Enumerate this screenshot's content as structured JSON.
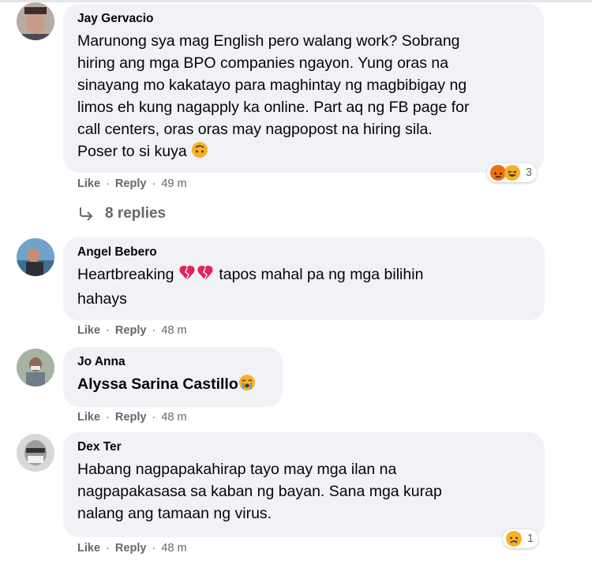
{
  "comments": [
    {
      "author": "Jay Gervacio",
      "text_lines": [
        "Marunong sya mag English pero walang work? Sobrang",
        "hiring ang mga BPO companies ngayon. Yung oras na",
        "sinayang mo kakatayo para maghintay ng magbibigay ng",
        "limos eh kung nagapply ka online. Part aq ng FB page for",
        "call centers, oras oras may nagpopost na hiring sila.",
        "Poser to si kuya"
      ],
      "like": "Like",
      "reply": "Reply",
      "time": "49 m",
      "reaction_count": "3",
      "reactions": [
        "angry-icon",
        "haha-icon"
      ],
      "replies_label": "8 replies"
    },
    {
      "author": "Angel Bebero",
      "text_line1_pre": "Heartbreaking",
      "text_line1_post": "tapos mahal pa ng mga bilihin",
      "text_line2": "hahays",
      "like": "Like",
      "reply": "Reply",
      "time": "48 m"
    },
    {
      "author": "Jo Anna",
      "mention": "Alyssa Sarina Castillo",
      "like": "Like",
      "reply": "Reply",
      "time": "48 m"
    },
    {
      "author": "Dex Ter",
      "text_lines": [
        "Habang nagpapakahirap tayo may mga ilan na",
        "nagpapakasasa sa kaban ng bayan. Sana mga kurap",
        "nalang ang tamaan ng virus."
      ],
      "like": "Like",
      "reply": "Reply",
      "time": "48 m",
      "reaction_count": "1",
      "reactions": [
        "sad-icon"
      ]
    }
  ],
  "separator": "·",
  "colors": {
    "bubble": "#f0f2f5",
    "meta_text": "#65676b",
    "angry": "#e9710f",
    "haha": "#f7b125",
    "heart_broken": "#e0245e"
  }
}
